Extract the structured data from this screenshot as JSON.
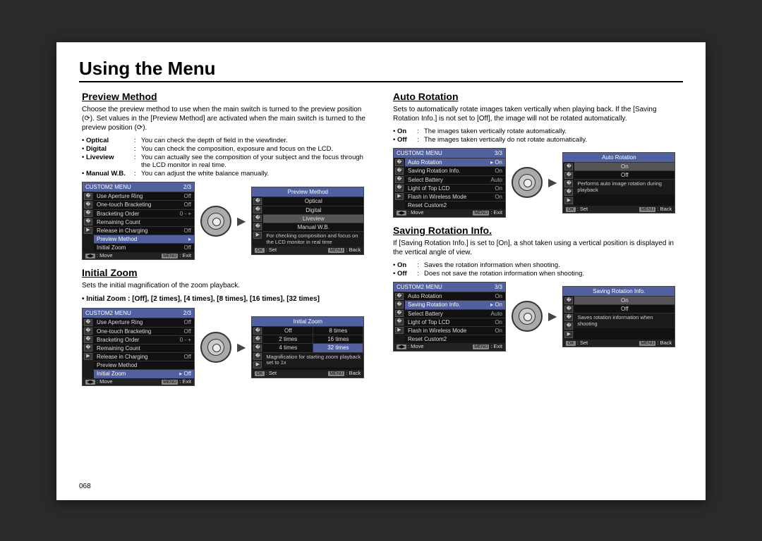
{
  "page_title": "Using the Menu",
  "page_number": "068",
  "left": {
    "preview_method": {
      "heading": "Preview Method",
      "para": "Choose the preview method to use when the main switch is turned to the preview position (⟳). Set values in the [Preview Method] are activated when the main switch is turned to the preview position (⟳).",
      "items": [
        {
          "label": "Optical",
          "desc": "You can check the depth of field in the viewfinder."
        },
        {
          "label": "Digital",
          "desc": "You can check the composition, exposure and focus on the LCD."
        },
        {
          "label": "Liveview",
          "desc": "You can actually see the composition of your subject and the focus through the LCD monitor in real time."
        },
        {
          "label": "Manual W.B.",
          "desc": "You can adjust the white balance manually."
        }
      ],
      "lcd_menu": {
        "title": "CUSTOM2 MENU",
        "page": "2/3",
        "rows": [
          {
            "name": "Use Aperture Ring",
            "value": "Off"
          },
          {
            "name": "One-touch Bracketing",
            "value": "Off"
          },
          {
            "name": "Bracketing Order",
            "value": "0 - +"
          },
          {
            "name": "Remaining Count",
            "value": ""
          },
          {
            "name": "Release in Charging",
            "value": "Off"
          },
          {
            "name": "Preview Method",
            "value": "▸",
            "selected": true
          },
          {
            "name": "Initial Zoom",
            "value": "Off"
          }
        ],
        "foot_left_icon": "◀▶",
        "foot_left": "Move",
        "foot_right_icon": "MENU",
        "foot_right": "Exit"
      },
      "lcd_sub": {
        "title": "Preview Method",
        "options": [
          "Optical",
          "Digital",
          "Liveview",
          "Manual W.B."
        ],
        "selected": "Liveview",
        "help": "For checking composition and focus on the LCD monitor in real time",
        "foot_left_icon": "OK",
        "foot_left": "Set",
        "foot_right_icon": "MENU",
        "foot_right": "Back"
      }
    },
    "initial_zoom": {
      "heading": "Initial Zoom",
      "para": "Sets the initial magnification of the zoom playback.",
      "options_line_label": "Initial Zoom :",
      "options_line_values": "[Off], [2 times], [4 times], [8 times], [16 times], [32 times]",
      "lcd_menu": {
        "title": "CUSTOM2 MENU",
        "page": "2/3",
        "rows": [
          {
            "name": "Use Aperture Ring",
            "value": "Off"
          },
          {
            "name": "One-touch Bracketing",
            "value": "Off"
          },
          {
            "name": "Bracketing Order",
            "value": "0 - +"
          },
          {
            "name": "Remaining Count",
            "value": ""
          },
          {
            "name": "Release in Charging",
            "value": "Off"
          },
          {
            "name": "Preview Method",
            "value": ""
          },
          {
            "name": "Initial Zoom",
            "value": "▸ Off",
            "selected": true
          }
        ],
        "foot_left_icon": "◀▶",
        "foot_left": "Move",
        "foot_right_icon": "MENU",
        "foot_right": "Exit"
      },
      "lcd_sub": {
        "title": "Initial Zoom",
        "grid": [
          {
            "label": "Off"
          },
          {
            "label": "8 times"
          },
          {
            "label": "2 times"
          },
          {
            "label": "16 times"
          },
          {
            "label": "4 times"
          },
          {
            "label": "32 times",
            "selected": true
          }
        ],
        "help": "Magnification for starting zoom playback set to 1x",
        "foot_left_icon": "OK",
        "foot_left": "Set",
        "foot_right_icon": "MENU",
        "foot_right": "Back"
      }
    }
  },
  "right": {
    "auto_rotation": {
      "heading": "Auto Rotation",
      "para": "Sets to automatically rotate images taken vertically when playing back. If the [Saving Rotation Info.] is not set to [Off], the image will not be rotated automatically.",
      "items": [
        {
          "label": "On",
          "desc": "The images taken vertically rotate automatically."
        },
        {
          "label": "Off",
          "desc": "The images taken vertically do not rotate automatically."
        }
      ],
      "lcd_menu": {
        "title": "CUSTOM2 MENU",
        "page": "3/3",
        "rows": [
          {
            "name": "Auto Rotation",
            "value": "▸ On",
            "selected": true
          },
          {
            "name": "Saving Rotation Info.",
            "value": "On"
          },
          {
            "name": "Select Battery",
            "value": "Auto"
          },
          {
            "name": "Light of Top LCD",
            "value": "On"
          },
          {
            "name": "Flash in Wireless Mode",
            "value": "On"
          },
          {
            "name": "Reset Custom2",
            "value": ""
          }
        ],
        "foot_left_icon": "◀▶",
        "foot_left": "Move",
        "foot_right_icon": "MENU",
        "foot_right": "Exit"
      },
      "lcd_sub": {
        "title": "Auto Rotation",
        "options": [
          "On",
          "Off"
        ],
        "selected": "On",
        "help": "Performs auto image rotation during playback",
        "foot_left_icon": "OK",
        "foot_left": "Set",
        "foot_right_icon": "MENU",
        "foot_right": "Back"
      }
    },
    "saving_rotation": {
      "heading": "Saving Rotation Info.",
      "para": "If [Saving Rotation Info.] is set to [On], a shot taken using a vertical position is displayed in the vertical angle of view.",
      "items": [
        {
          "label": "On",
          "desc": "Saves the rotation information when shooting."
        },
        {
          "label": "Off",
          "desc": "Does not save the rotation information when shooting."
        }
      ],
      "lcd_menu": {
        "title": "CUSTOM2 MENU",
        "page": "3/3",
        "rows": [
          {
            "name": "Auto Rotation",
            "value": "On"
          },
          {
            "name": "Saving Rotation Info.",
            "value": "▸ On",
            "selected": true
          },
          {
            "name": "Select Battery",
            "value": "Auto"
          },
          {
            "name": "Light of Top LCD",
            "value": "On"
          },
          {
            "name": "Flash in Wireless Mode",
            "value": "On"
          },
          {
            "name": "Reset Custom2",
            "value": ""
          }
        ],
        "foot_left_icon": "◀▶",
        "foot_left": "Move",
        "foot_right_icon": "MENU",
        "foot_right": "Exit"
      },
      "lcd_sub": {
        "title": "Saving Rotation Info.",
        "options": [
          "On",
          "Off"
        ],
        "selected": "On",
        "help": "Saves rotation information when shooting",
        "foot_left_icon": "OK",
        "foot_left": "Set",
        "foot_right_icon": "MENU",
        "foot_right": "Back"
      }
    }
  },
  "side_icons": [
    "📷",
    "👤₁",
    "👤₂",
    "🔧",
    "▶"
  ]
}
